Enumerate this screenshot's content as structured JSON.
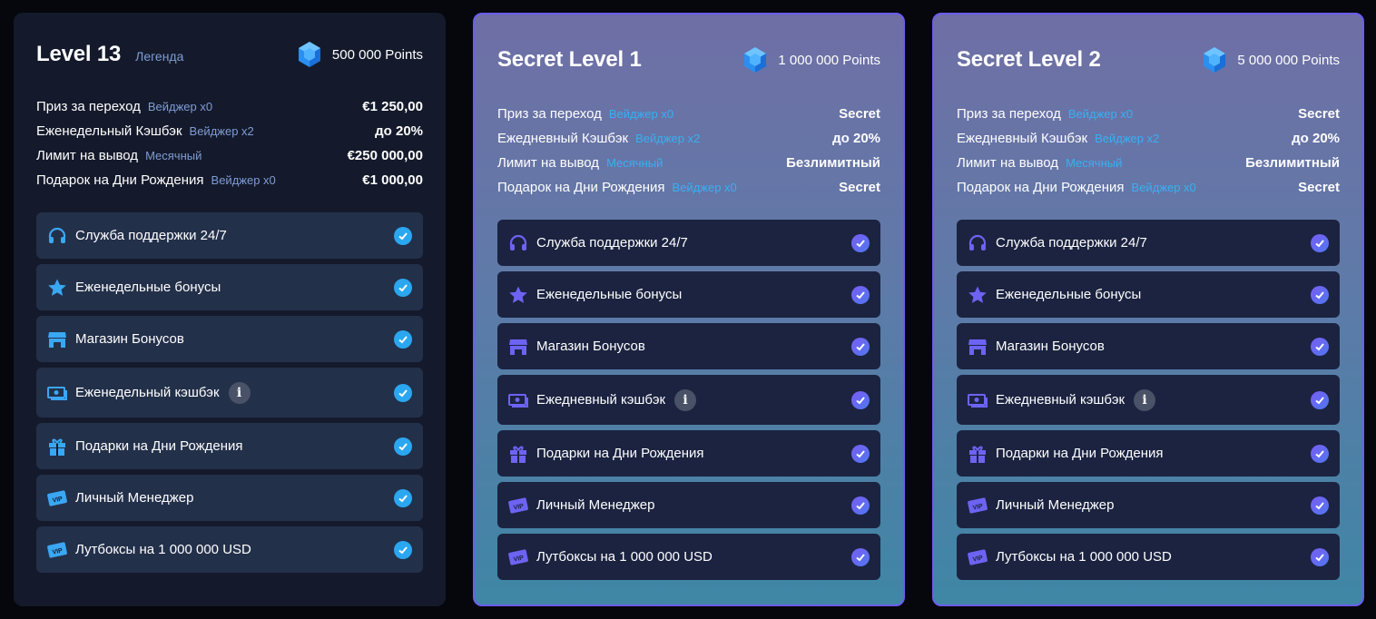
{
  "colors": {
    "accent_blue": "#2aa7f0",
    "accent_purple": "#6d5cf0",
    "card_bg": "#141a2b"
  },
  "cards": [
    {
      "title": "Level 13",
      "subtitle": "Легенда",
      "points": "500 000 Points",
      "stats": [
        {
          "label": "Приз за переход",
          "wager": "Вейджер x0",
          "value": "€1 250,00"
        },
        {
          "label": "Еженедельный Кэшбэк",
          "wager": "Вейджер x2",
          "value": "до 20%"
        },
        {
          "label": "Лимит на вывод",
          "wager": "Месячный",
          "value": "€250 000,00"
        },
        {
          "label": "Подарок на Дни Рождения",
          "wager": "Вейджер x0",
          "value": "€1 000,00"
        }
      ],
      "features": [
        {
          "icon": "headset-icon",
          "label": "Служба поддержки 24/7"
        },
        {
          "icon": "star-icon",
          "label": "Еженедельные бонусы"
        },
        {
          "icon": "store-icon",
          "label": "Магазин Бонусов"
        },
        {
          "icon": "cash-icon",
          "label": "Еженедельный кэшбэк"
        },
        {
          "icon": "gift-icon",
          "label": "Подарки на Дни Рождения"
        },
        {
          "icon": "vip-icon",
          "label": "Личный Менеджер"
        },
        {
          "icon": "vip-icon",
          "label": "Лутбоксы на 1 000 000 USD"
        }
      ]
    },
    {
      "title": "Secret Level 1",
      "points": "1 000 000 Points",
      "stats": [
        {
          "label": "Приз за переход",
          "wager": "Вейджер x0",
          "value": "Secret"
        },
        {
          "label": "Ежедневный Кэшбэк",
          "wager": "Вейджер x2",
          "value": "до 20%"
        },
        {
          "label": "Лимит на вывод",
          "wager": "Месячный",
          "value": "Безлимитный"
        },
        {
          "label": "Подарок на Дни Рождения",
          "wager": "Вейджер x0",
          "value": "Secret"
        }
      ],
      "features": [
        {
          "icon": "headset-icon",
          "label": "Служба поддержки 24/7"
        },
        {
          "icon": "star-icon",
          "label": "Еженедельные бонусы"
        },
        {
          "icon": "store-icon",
          "label": "Магазин Бонусов"
        },
        {
          "icon": "cash-icon",
          "label": "Ежедневный кэшбэк"
        },
        {
          "icon": "gift-icon",
          "label": "Подарки на Дни Рождения"
        },
        {
          "icon": "vip-icon",
          "label": "Личный Менеджер"
        },
        {
          "icon": "vip-icon",
          "label": "Лутбоксы на 1 000 000 USD"
        }
      ]
    },
    {
      "title": "Secret Level 2",
      "points": "5 000 000 Points",
      "stats": [
        {
          "label": "Приз за переход",
          "wager": "Вейджер x0",
          "value": "Secret"
        },
        {
          "label": "Ежедневный Кэшбэк",
          "wager": "Вейджер x2",
          "value": "до 20%"
        },
        {
          "label": "Лимит на вывод",
          "wager": "Месячный",
          "value": "Безлимитный"
        },
        {
          "label": "Подарок на Дни Рождения",
          "wager": "Вейджер x0",
          "value": "Secret"
        }
      ],
      "features": [
        {
          "icon": "headset-icon",
          "label": "Служба поддержки 24/7"
        },
        {
          "icon": "star-icon",
          "label": "Еженедельные бонусы"
        },
        {
          "icon": "store-icon",
          "label": "Магазин Бонусов"
        },
        {
          "icon": "cash-icon",
          "label": "Ежедневный кэшбэк"
        },
        {
          "icon": "gift-icon",
          "label": "Подарки на Дни Рождения"
        },
        {
          "icon": "vip-icon",
          "label": "Личный Менеджер"
        },
        {
          "icon": "vip-icon",
          "label": "Лутбоксы на 1 000 000 USD"
        }
      ]
    }
  ]
}
